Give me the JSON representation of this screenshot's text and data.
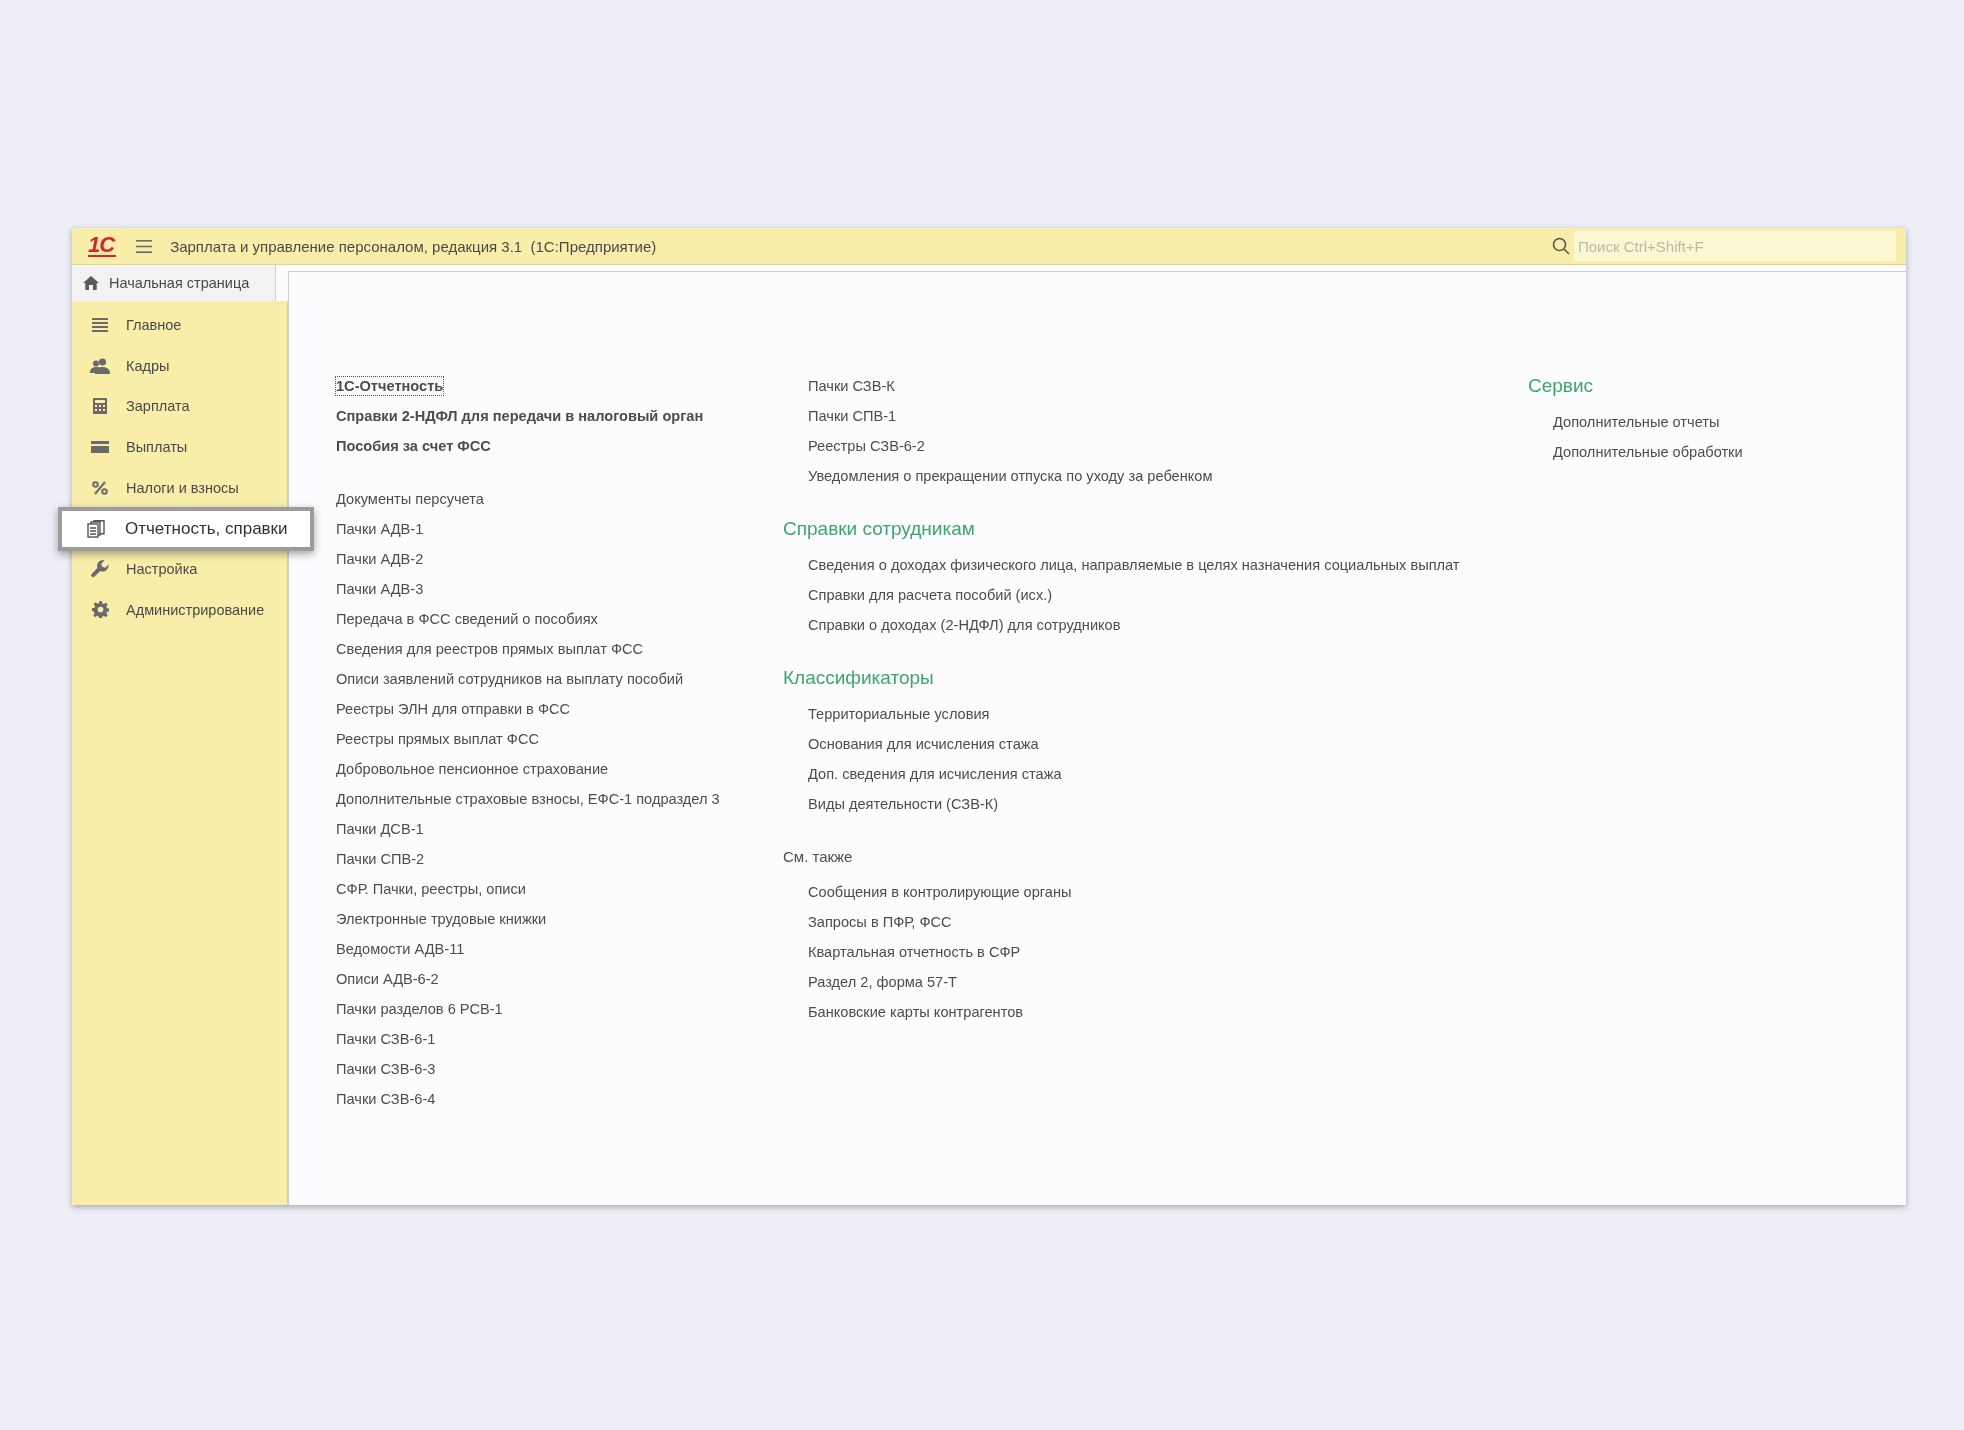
{
  "window": {
    "logo": "1С",
    "title": "Зарплата и управление персоналом, редакция 3.1  (1С:Предприятие)"
  },
  "search": {
    "placeholder": "Поиск Ctrl+Shift+F"
  },
  "home_tab": {
    "label": "Начальная страница"
  },
  "sidebar": {
    "items": [
      {
        "label": "Главное",
        "selected": false
      },
      {
        "label": "Кадры",
        "selected": false
      },
      {
        "label": "Зарплата",
        "selected": false
      },
      {
        "label": "Выплаты",
        "selected": false
      },
      {
        "label": "Налоги и взносы",
        "selected": false
      },
      {
        "label": "Отчетность, справки",
        "selected": true
      },
      {
        "label": "Настройка",
        "selected": false
      },
      {
        "label": "Администрирование",
        "selected": false
      }
    ]
  },
  "columns": [
    {
      "kind": "plain",
      "sections": [
        {
          "links": [
            {
              "label": "1С-Отчетность",
              "bold": true,
              "focused": true
            },
            {
              "label": "Справки 2-НДФЛ для передачи в налоговый орган",
              "bold": true,
              "focused": false
            },
            {
              "label": "Пособия за счет ФСС",
              "bold": true,
              "focused": false
            }
          ]
        },
        {
          "links": [
            {
              "label": "Документы персучета",
              "bold": false,
              "focused": false
            },
            {
              "label": "Пачки АДВ-1",
              "bold": false,
              "focused": false
            },
            {
              "label": "Пачки АДВ-2",
              "bold": false,
              "focused": false
            },
            {
              "label": "Пачки АДВ-3",
              "bold": false,
              "focused": false
            },
            {
              "label": "Передача в ФСС сведений о пособиях",
              "bold": false,
              "focused": false
            },
            {
              "label": "Сведения для реестров прямых выплат ФСС",
              "bold": false,
              "focused": false
            },
            {
              "label": "Описи заявлений сотрудников на выплату пособий",
              "bold": false,
              "focused": false
            },
            {
              "label": "Реестры ЭЛН для отправки в ФСС",
              "bold": false,
              "focused": false
            },
            {
              "label": "Реестры прямых выплат ФСС",
              "bold": false,
              "focused": false
            },
            {
              "label": "Добровольное пенсионное страхование",
              "bold": false,
              "focused": false
            },
            {
              "label": "Дополнительные страховые взносы, ЕФС-1 подраздел 3",
              "bold": false,
              "focused": false
            },
            {
              "label": "Пачки ДСВ-1",
              "bold": false,
              "focused": false
            },
            {
              "label": "Пачки СПВ-2",
              "bold": false,
              "focused": false
            },
            {
              "label": "СФР. Пачки, реестры, описи",
              "bold": false,
              "focused": false
            },
            {
              "label": "Электронные трудовые книжки",
              "bold": false,
              "focused": false
            },
            {
              "label": "Ведомости АДВ-11",
              "bold": false,
              "focused": false
            },
            {
              "label": "Описи АДВ-6-2",
              "bold": false,
              "focused": false
            },
            {
              "label": "Пачки разделов 6 РСВ-1",
              "bold": false,
              "focused": false
            },
            {
              "label": "Пачки СЗВ-6-1",
              "bold": false,
              "focused": false
            },
            {
              "label": "Пачки СЗВ-6-3",
              "bold": false,
              "focused": false
            },
            {
              "label": "Пачки СЗВ-6-4",
              "bold": false,
              "focused": false
            }
          ]
        }
      ]
    },
    {
      "kind": "grouped",
      "sections": [
        {
          "links": [
            {
              "label": "Пачки СЗВ-К",
              "bold": false,
              "focused": false
            },
            {
              "label": "Пачки СПВ-1",
              "bold": false,
              "focused": false
            },
            {
              "label": "Реестры СЗВ-6-2",
              "bold": false,
              "focused": false
            },
            {
              "label": "Уведомления о прекращении отпуска по уходу за ребенком",
              "bold": false,
              "focused": false
            }
          ]
        },
        {
          "heading": "Справки сотрудникам",
          "kind": "group",
          "links": [
            {
              "label": "Сведения о доходах физического лица, направляемые в целях назначения социальных выплат",
              "bold": false,
              "focused": false
            },
            {
              "label": "Справки для расчета пособий (исх.)",
              "bold": false,
              "focused": false
            },
            {
              "label": "Справки о доходах (2-НДФЛ) для сотрудников",
              "bold": false,
              "focused": false
            }
          ]
        },
        {
          "heading": "Классификаторы",
          "kind": "group",
          "links": [
            {
              "label": "Территориальные условия",
              "bold": false,
              "focused": false
            },
            {
              "label": "Основания для исчисления стажа",
              "bold": false,
              "focused": false
            },
            {
              "label": "Доп. сведения для исчисления стажа",
              "bold": false,
              "focused": false
            },
            {
              "label": "Виды деятельности (СЗВ-К)",
              "bold": false,
              "focused": false
            }
          ]
        },
        {
          "heading": "См. также",
          "kind": "see_also",
          "links": [
            {
              "label": "Сообщения в контролирующие органы",
              "bold": false,
              "focused": false
            },
            {
              "label": "Запросы в ПФР, ФСС",
              "bold": false,
              "focused": false
            },
            {
              "label": "Квартальная отчетность в СФР",
              "bold": false,
              "focused": false
            },
            {
              "label": "Раздел 2, форма 57-Т",
              "bold": false,
              "focused": false
            },
            {
              "label": "Банковские карты контрагентов",
              "bold": false,
              "focused": false
            }
          ]
        }
      ]
    },
    {
      "kind": "grouped",
      "sections": [
        {
          "heading": "Сервис",
          "kind": "group",
          "links": [
            {
              "label": "Дополнительные отчеты",
              "bold": false,
              "focused": false
            },
            {
              "label": "Дополнительные обработки",
              "bold": false,
              "focused": false
            }
          ]
        }
      ]
    }
  ]
}
